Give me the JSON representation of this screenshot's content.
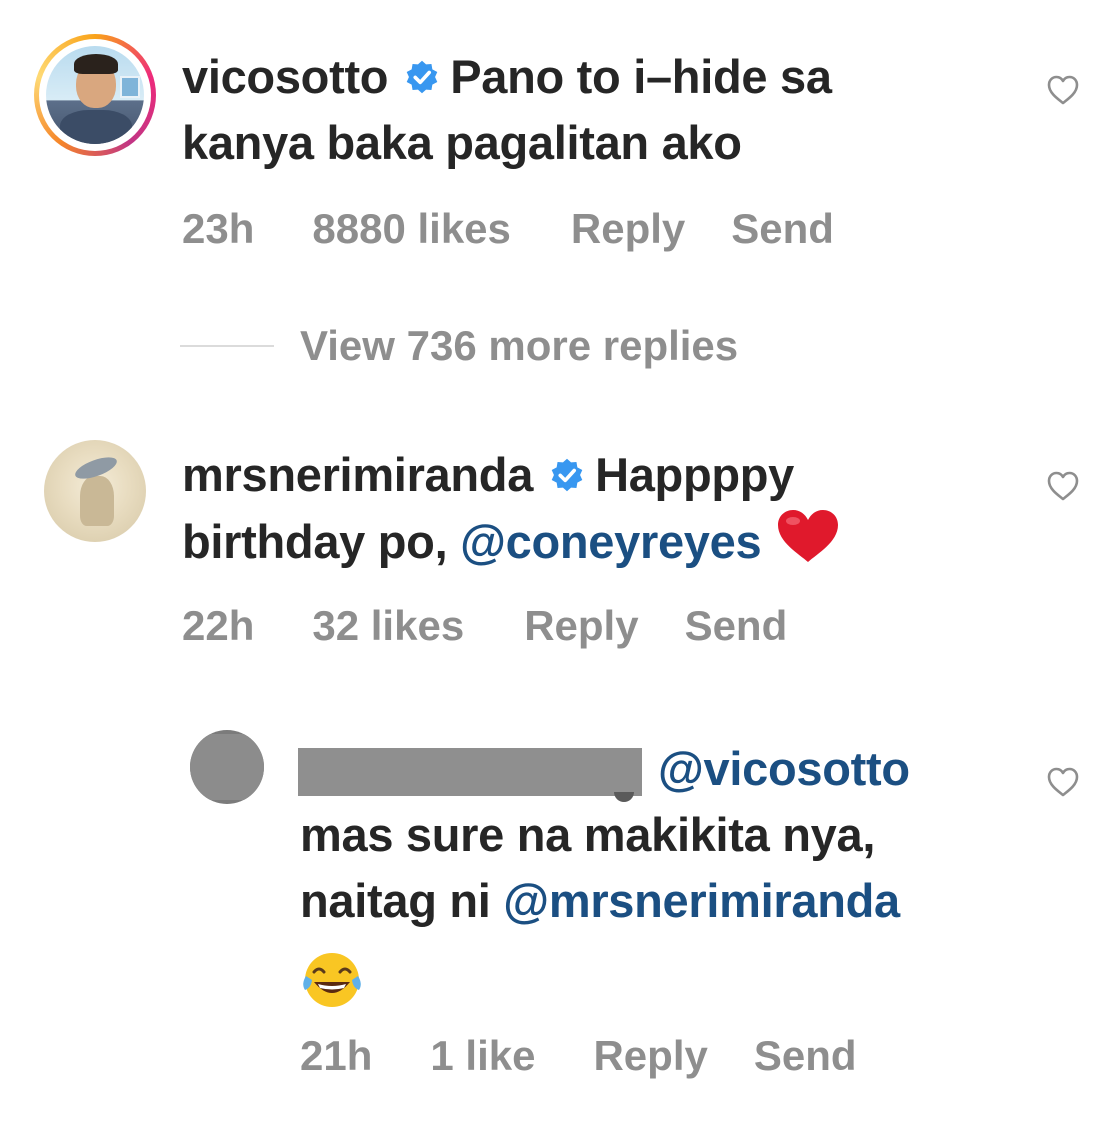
{
  "comments": [
    {
      "username": "vicosotto",
      "text_line1": "Pano to i–hide sa",
      "text_line2": "kanya baka pagalitan ako",
      "time": "23h",
      "likes": "8880 likes",
      "reply": "Reply",
      "send": "Send"
    },
    {
      "username": "mrsnerimiranda",
      "text_line1": "Happppy",
      "text_line2a": "birthday po, ",
      "mention": "@coneyreyes",
      "time": "22h",
      "likes": "32 likes",
      "reply": "Reply",
      "send": "Send"
    },
    {
      "mention1": "@vicosotto",
      "text_line2": "mas sure na makikita nya,",
      "text_line3a": "naitag ni ",
      "mention2": "@mrsnerimiranda",
      "time": "21h",
      "likes": "1 like",
      "reply": "Reply",
      "send": "Send"
    }
  ],
  "view_more": "View 736 more replies",
  "icons": {
    "verified": "verified-badge-icon",
    "like": "heart-outline-icon",
    "red_heart": "red-heart-emoji",
    "laugh": "tears-of-joy-emoji"
  },
  "colors": {
    "text": "#262626",
    "meta": "#8e8e8e",
    "mention": "#1b4f82",
    "verified": "#3897f0"
  }
}
